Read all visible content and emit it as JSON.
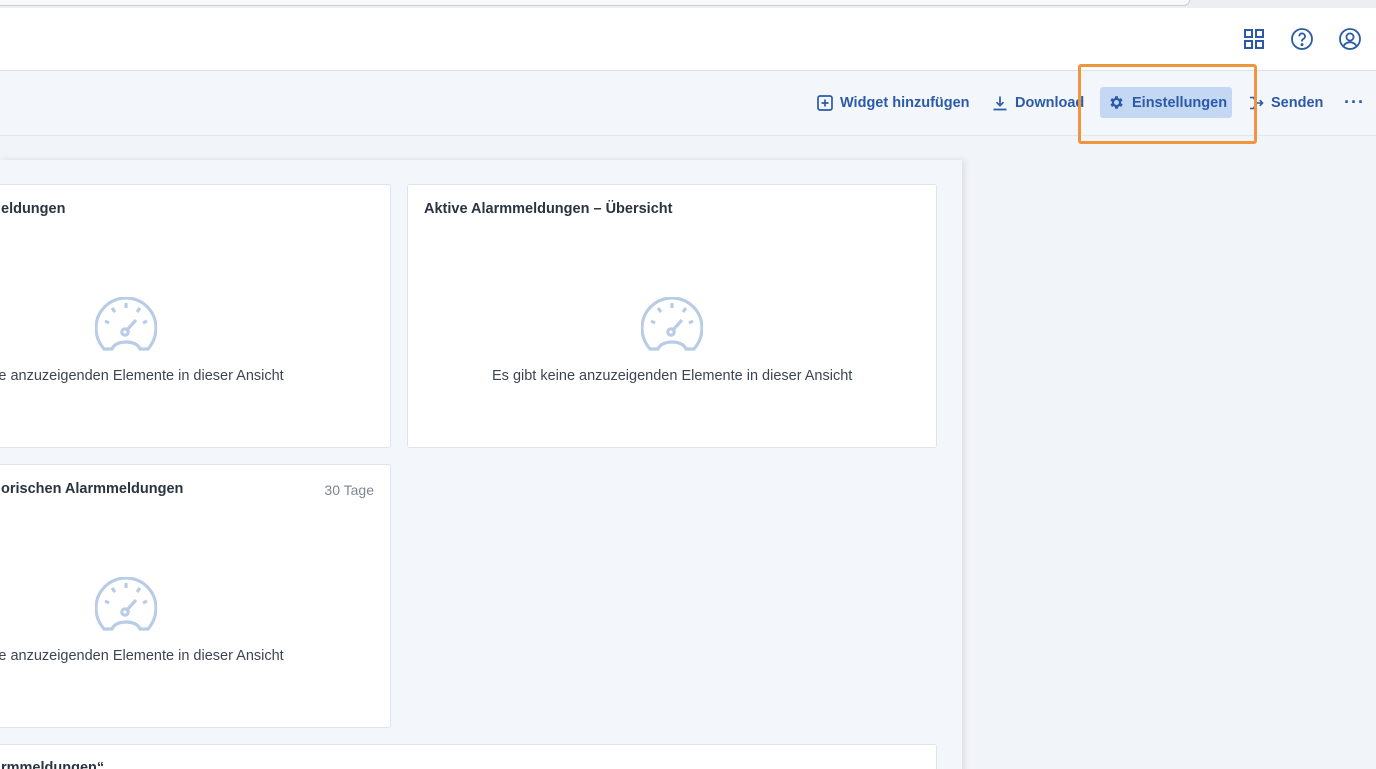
{
  "header": {
    "icons": [
      "apps-grid-icon",
      "help-icon",
      "user-account-icon"
    ]
  },
  "toolbar": {
    "add_widget": "Widget hinzufügen",
    "download": "Download",
    "settings": "Einstellungen",
    "send": "Senden",
    "more": "···"
  },
  "widgets": [
    {
      "title": "eldungen",
      "empty_text": "eine anzuzeigenden Elemente in dieser Ansicht"
    },
    {
      "title": "Aktive Alarmmeldungen – Übersicht",
      "empty_text": "Es gibt keine anzuzeigenden Elemente in dieser Ansicht"
    },
    {
      "title": "orischen Alarmmeldungen",
      "meta": "30 Tage",
      "empty_text": "eine anzuzeigenden Elemente in dieser Ansicht"
    },
    {
      "title": "rmmeldungen“"
    }
  ],
  "colors": {
    "accent": "#2b5aa8",
    "active_bg": "#c4d8f4",
    "highlight": "#f0953f",
    "empty_icon": "#b9cce6"
  }
}
